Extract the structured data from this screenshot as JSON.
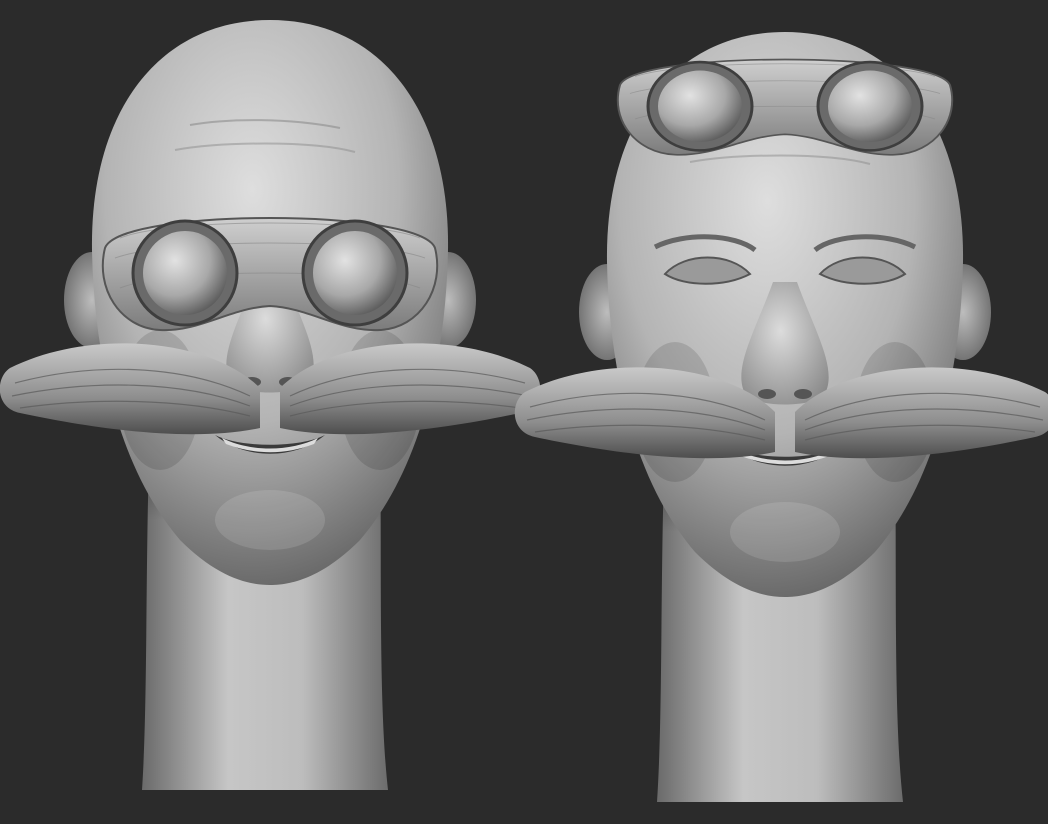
{
  "scene": {
    "subject": "two-sculpted-heads-with-goggles-and-mustache",
    "background_color": "#2b2b2b",
    "clay_light": "#d4d4d4",
    "clay_mid": "#9a9a9a",
    "clay_dark": "#4a4a4a"
  },
  "heads": [
    {
      "name": "head-goggles-on-eyes",
      "goggles_position": "over-eyes"
    },
    {
      "name": "head-goggles-on-forehead",
      "goggles_position": "on-forehead"
    }
  ]
}
